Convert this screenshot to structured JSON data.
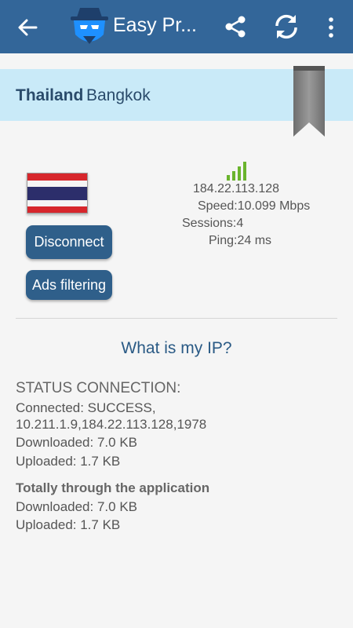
{
  "appbar": {
    "title": "Easy Pr...",
    "back_icon": "arrow-left-icon",
    "logo_icon": "spy-agent-shield-icon",
    "share_icon": "share-icon",
    "refresh_icon": "refresh-icon",
    "more_icon": "more-vertical-icon",
    "color": "#336699"
  },
  "server": {
    "country": "Thailand",
    "city": "Bangkok",
    "bookmark_icon": "bookmark-ribbon-icon",
    "bar_color": "#c9eaf8"
  },
  "connection": {
    "flag_icon": "thailand-flag-icon",
    "signal_icon": "signal-strength-icon",
    "signal_level": 4,
    "ip": "184.22.113.128",
    "speed": "Speed:10.099 Mbps",
    "sessions": "Sessions:4",
    "ping": "Ping:24 ms"
  },
  "buttons": {
    "disconnect": "Disconnect",
    "ads_filtering": "Ads filtering",
    "color": "#2f5f8a"
  },
  "what_is_my_ip": "What is my IP?",
  "status": {
    "title": "STATUS CONNECTION:",
    "connected_line1": "Connected: SUCCESS,",
    "connected_line2": "10.211.1.9,184.22.113.128,1978",
    "downloaded": "Downloaded: 7.0 KB",
    "uploaded": "Uploaded: 1.7 KB"
  },
  "totals": {
    "title": "Totally through the application",
    "downloaded": "Downloaded: 7.0 KB",
    "uploaded": "Uploaded: 1.7 KB"
  }
}
